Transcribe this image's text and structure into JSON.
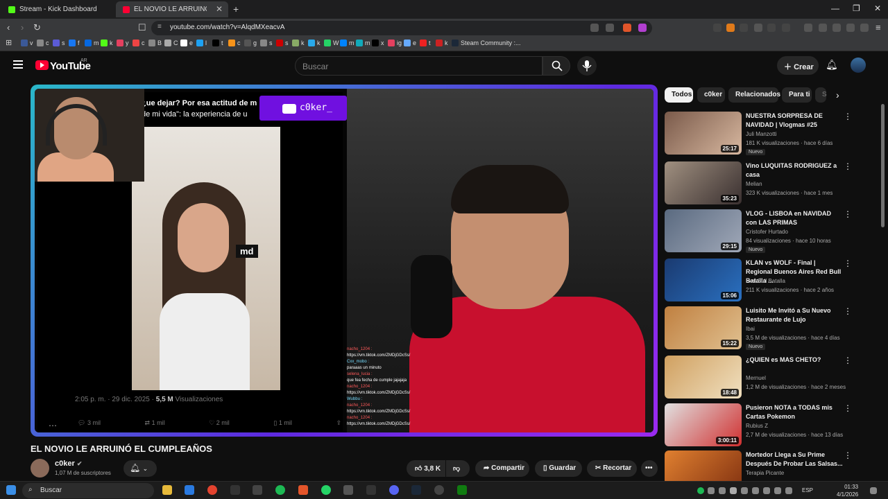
{
  "browser": {
    "tabs": [
      {
        "label": "Stream - Kick Dashboard",
        "color": "#53fc18"
      },
      {
        "label": "EL NOVIO LE ARRUINÓ EL CU",
        "color": "#ff0033"
      }
    ],
    "url": "youtube.com/watch?v=AlqdMXeacvA",
    "bookmarks": [
      "v",
      "c",
      "s",
      "f",
      "m",
      "k",
      "y",
      "c",
      "B",
      "C",
      "e",
      "l",
      "t",
      "c",
      "g",
      "s",
      "s",
      "k",
      "k",
      "W",
      "m",
      "m",
      "x",
      "ig",
      "e",
      "t",
      "k",
      "Steam Community :..."
    ]
  },
  "youtube": {
    "logo_text": "YouTube",
    "country": "AR",
    "search_placeholder": "Buscar",
    "create_label": "Crear"
  },
  "video": {
    "tweet_text_1": "¿ue dejar? Por esa actitud de m",
    "tweet_text_2": "de mi vida\": la experiencia de u",
    "streamer_badge": "c0ker_",
    "md_label": "md",
    "tweet_date": "2:05 p. m. · 29 dic. 2025 · ",
    "tweet_views": "5,5 M",
    "tweet_views_label": " Visualizaciones",
    "tweet_replies": "3 mil",
    "tweet_retweets": "1 mil",
    "tweet_likes": "2 mil",
    "tweet_bookmarks": "1 mil",
    "chat": [
      {
        "user": "nacho_1204 :",
        "msg": "https://vm.tiktok.com/ZMDjGDcSs/"
      },
      {
        "user": "Cxx_mobo :",
        "msg": "paraaas un minuto"
      },
      {
        "user": "selena_lucia :",
        "msg": "que fea fecha de cumple jajajaja"
      },
      {
        "user": "nacho_1204 :",
        "msg": "https://vm.tiktok.com/ZMDjGDcSs/"
      },
      {
        "user": "Wubbu :",
        "msg": ""
      },
      {
        "user": "nacho_1204 :",
        "msg": "https://vm.tiktok.com/ZMDjGDcSs/"
      },
      {
        "user": "nacho_1204 :",
        "msg": "https://vm.tiktok.com/ZMDjGDcSs/"
      }
    ],
    "title": "EL NOVIO LE ARRUINÓ EL CUMPLEAÑOS",
    "channel": "c0ker",
    "subscribers": "1,07 M de suscriptores",
    "likes": "3,8 K",
    "share_label": "Compartir",
    "save_label": "Guardar",
    "clip_label": "Recortar"
  },
  "chips": [
    "Todos",
    "c0ker",
    "Relacionados",
    "Para ti",
    "S"
  ],
  "recommendations": [
    {
      "title": "NUESTRA SORPRESA DE NAVIDAD | Vlogmas #25",
      "channel": "Juli Manzotti",
      "views": "181 K visualizaciones · hace 6 días",
      "duration": "25:17",
      "badge": "Nuevo",
      "c1": "#7a5a4a",
      "c2": "#d8b8a0"
    },
    {
      "title": "Vino LUQUITAS RODRIGUEZ a casa",
      "channel": "Melian",
      "views": "323 K visualizaciones · hace 1 mes",
      "duration": "35:23",
      "badge": "",
      "c1": "#a09080",
      "c2": "#3a3030"
    },
    {
      "title": "VLOG - LISBOA en NAVIDAD con LAS PRIMAS",
      "channel": "Cristofer Hurtado",
      "views": "84 visualizaciones · hace 10 horas",
      "duration": "29:15",
      "badge": "Nuevo",
      "c1": "#5a6a80",
      "c2": "#a0a8b8"
    },
    {
      "title": "KLAN vs WOLF - Final | Regional Buenos Aires Red Bull Batalla ...",
      "channel": "Red Bull Batalla",
      "views": "211 K visualizaciones · hace 2 años",
      "duration": "15:06",
      "badge": "",
      "c1": "#1a3a70",
      "c2": "#2a70c0"
    },
    {
      "title": "Luisito Me Invitó a Su Nuevo Restaurante de Lujo",
      "channel": "Ibai",
      "views": "3,5 M de visualizaciones · hace 4 días",
      "duration": "15:22",
      "badge": "Nuevo",
      "c1": "#c08040",
      "c2": "#e0c090"
    },
    {
      "title": "¿QUIEN es MAS CHETO?",
      "channel": "Mernuel",
      "views": "1,2 M de visualizaciones · hace 2 meses",
      "duration": "18:48",
      "badge": "",
      "c1": "#d0a060",
      "c2": "#f0e0c0"
    },
    {
      "title": "Pusieron NOTA a TODAS mis Cartas Pokemon",
      "channel": "Rubius Z",
      "views": "2,7 M de visualizaciones · hace 13 días",
      "duration": "3:00:11",
      "badge": "",
      "c1": "#e0e0e0",
      "c2": "#d03030"
    },
    {
      "title": "Mortedor Llega a Su Prime Después De Probar Las Salsas...",
      "channel": "Terapia Picante",
      "views": "",
      "duration": "",
      "badge": "",
      "c1": "#e08030",
      "c2": "#803010"
    }
  ],
  "taskbar": {
    "search": "Buscar",
    "lang": "ESP",
    "time": "01:33",
    "date": "4/1/2026"
  }
}
